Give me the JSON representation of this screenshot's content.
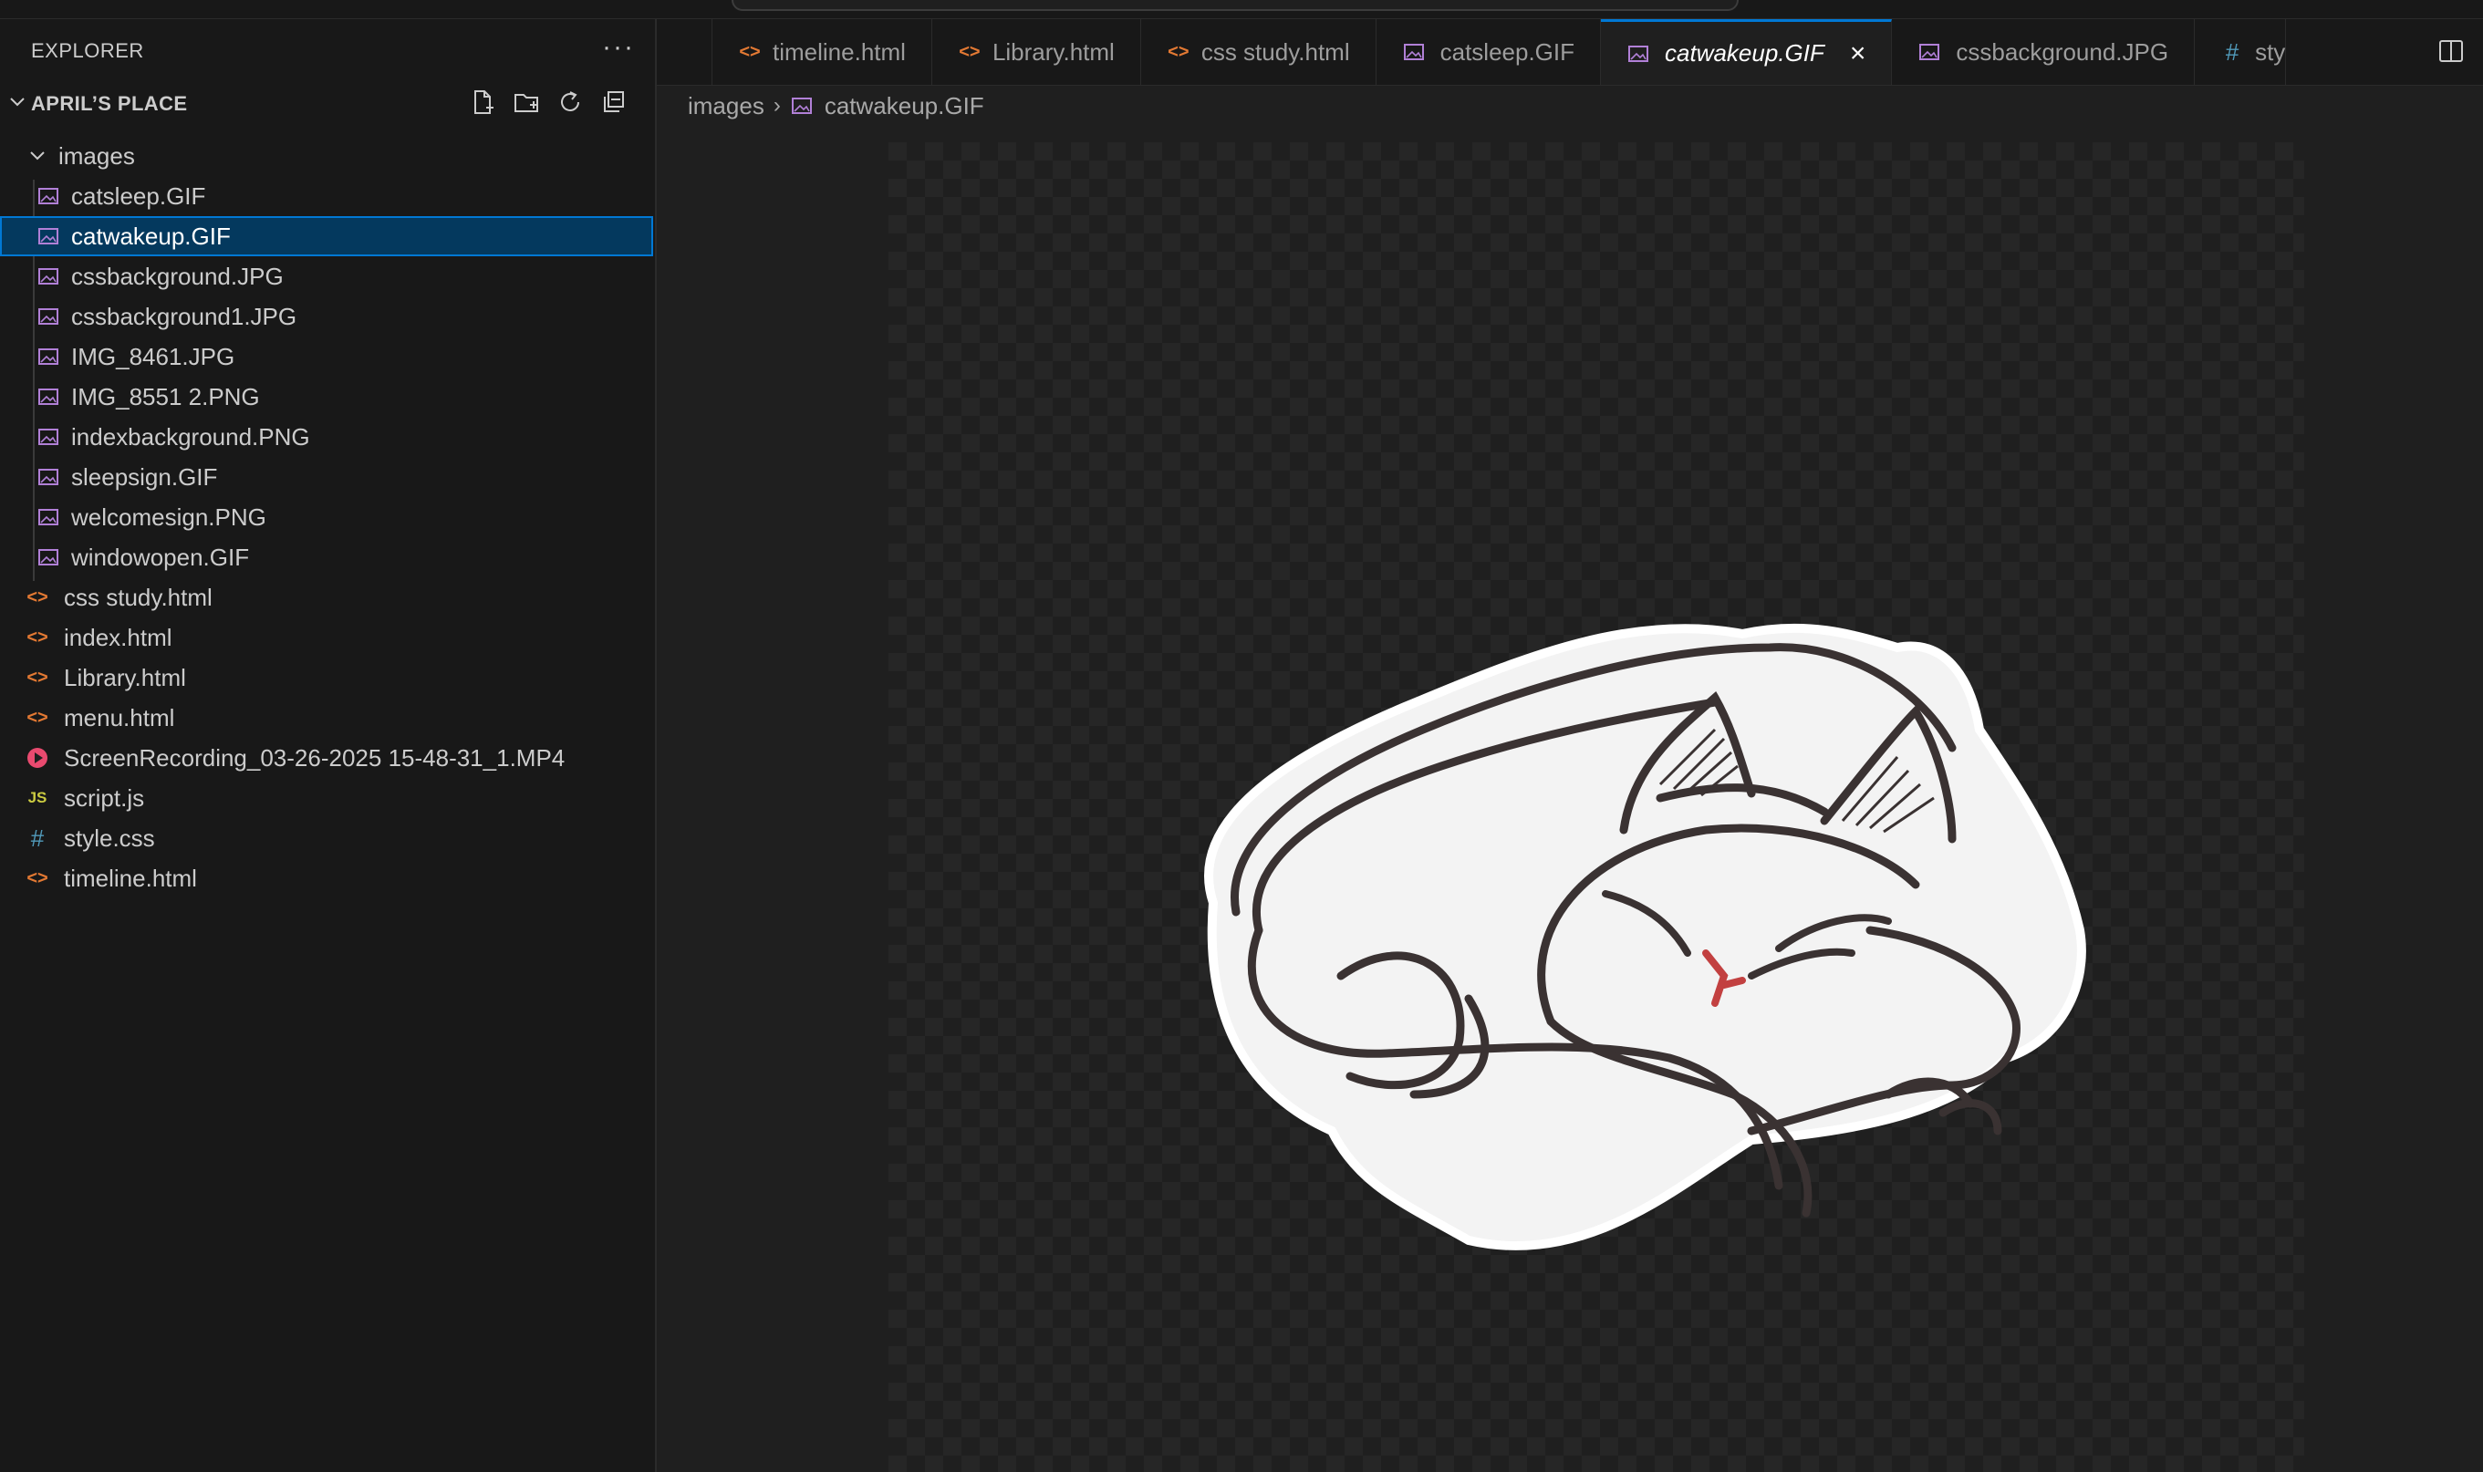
{
  "explorer": {
    "title": "EXPLORER",
    "more": "···",
    "folder_name": "APRIL’S PLACE"
  },
  "tree": {
    "images_folder": "images",
    "images": [
      "catsleep.GIF",
      "catwakeup.GIF",
      "cssbackground.JPG",
      "cssbackground1.JPG",
      "IMG_8461.JPG",
      "IMG_8551 2.PNG",
      "indexbackground.PNG",
      "sleepsign.GIF",
      "welcomesign.PNG",
      "windowopen.GIF"
    ],
    "files": [
      "css study.html",
      "index.html",
      "Library.html",
      "menu.html",
      "ScreenRecording_03-26-2025 15-48-31_1.MP4",
      "script.js",
      "style.css",
      "timeline.html"
    ],
    "js_badge": "JS",
    "css_badge": "#",
    "html_badge": "<>"
  },
  "tabs": [
    {
      "label": "timeline.html",
      "icon": "html"
    },
    {
      "label": "Library.html",
      "icon": "html"
    },
    {
      "label": "css study.html",
      "icon": "html"
    },
    {
      "label": "catsleep.GIF",
      "icon": "image"
    },
    {
      "label": "catwakeup.GIF",
      "icon": "image",
      "active": true
    },
    {
      "label": "cssbackground.JPG",
      "icon": "image"
    },
    {
      "label": "sty",
      "icon": "css"
    }
  ],
  "tab_close": "×",
  "breadcrumb": {
    "folder": "images",
    "file": "catwakeup.GIF",
    "sep": "›"
  },
  "colors": {
    "accent": "#0078d4",
    "selection": "#04395e",
    "html_icon": "#e37933",
    "image_icon": "#b180d7",
    "js_icon": "#cbcb41",
    "css_icon": "#519aba",
    "mp4_icon": "#e94a6f"
  }
}
